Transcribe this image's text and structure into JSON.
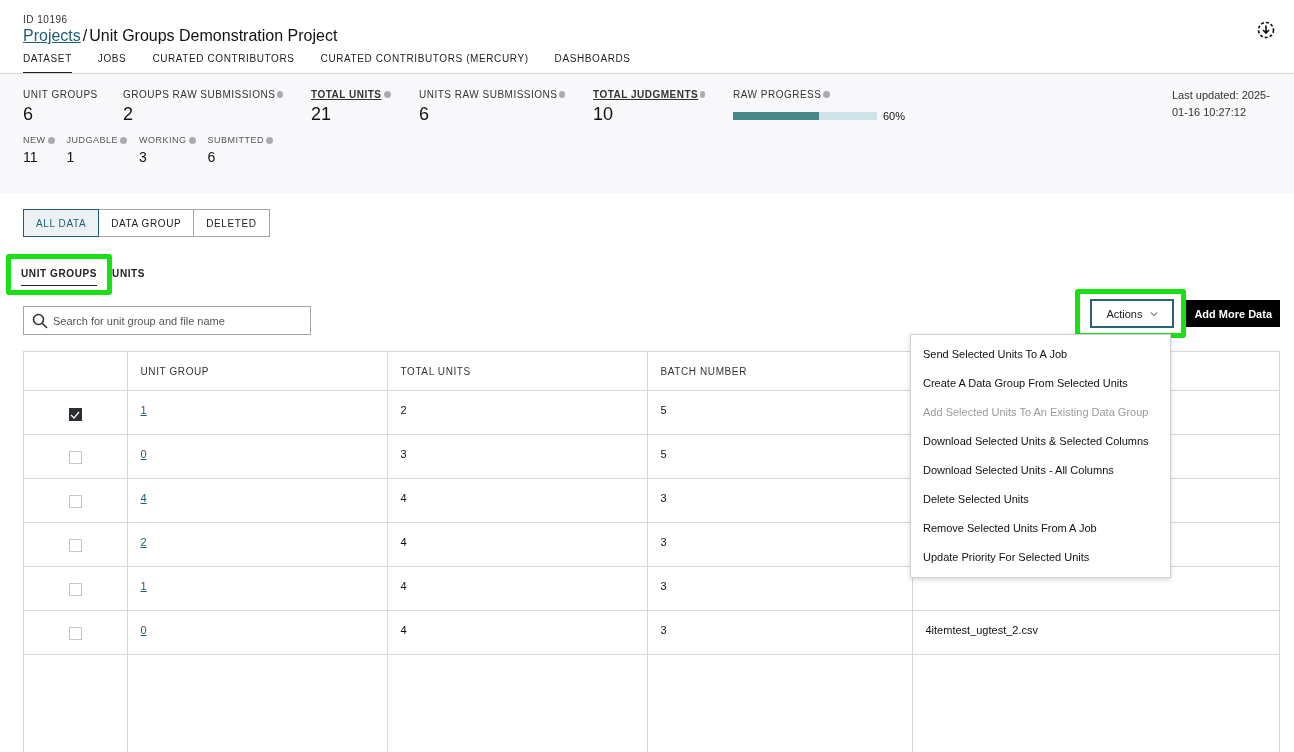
{
  "header": {
    "id_label": "ID 10196",
    "breadcrumb_link": "Projects",
    "separator": "/",
    "title": "Unit Groups Demonstration Project"
  },
  "nav_tabs": [
    {
      "label": "DATASET",
      "selected": true
    },
    {
      "label": "JOBS",
      "selected": false
    },
    {
      "label": "CURATED CONTRIBUTORS",
      "selected": false
    },
    {
      "label": "CURATED CONTRIBUTORS (MERCURY)",
      "selected": false
    },
    {
      "label": "DASHBOARDS",
      "selected": false
    }
  ],
  "stats": [
    {
      "label": "UNIT GROUPS",
      "value": "6",
      "info": false,
      "underlined": false
    },
    {
      "label": "GROUPS RAW SUBMISSIONS",
      "value": "2",
      "info": true,
      "underlined": false
    },
    {
      "label": "TOTAL UNITS",
      "value": "21",
      "info": true,
      "underlined": true
    },
    {
      "label": "UNITS RAW SUBMISSIONS",
      "value": "6",
      "info": true,
      "underlined": false
    },
    {
      "label": "TOTAL JUDGMENTS",
      "value": "10",
      "info": true,
      "underlined": true
    }
  ],
  "raw_progress": {
    "label": "RAW PROGRESS",
    "level": 0.6,
    "reading": "60%"
  },
  "last_updated": "Last updated: 2025-01-16 10:27:12",
  "sub_stats": [
    {
      "label": "NEW",
      "value": "11"
    },
    {
      "label": "JUDGABLE",
      "value": "1"
    },
    {
      "label": "WORKING",
      "value": "3"
    },
    {
      "label": "SUBMITTED",
      "value": "6"
    }
  ],
  "segments": [
    {
      "label": "ALL DATA",
      "selected": true
    },
    {
      "label": "DATA GROUP",
      "selected": false
    },
    {
      "label": "DELETED",
      "selected": false
    }
  ],
  "view_tabs": [
    {
      "label": "UNIT GROUPS",
      "selected": true,
      "highlighted": true
    },
    {
      "label": "UNITS",
      "selected": false,
      "highlighted": false
    }
  ],
  "search": {
    "placeholder": "Search for unit group and file name"
  },
  "actions_button": {
    "label": "Actions",
    "highlighted": true
  },
  "add_button": "Add More Data",
  "actions_menu": [
    {
      "label": "Send Selected Units To A Job",
      "disabled": false
    },
    {
      "label": "Create A Data Group From Selected Units",
      "disabled": false
    },
    {
      "label": "Add Selected Units To An Existing Data Group",
      "disabled": true
    },
    {
      "label": "Download Selected Units & Selected Columns",
      "disabled": false
    },
    {
      "label": "Download Selected Units - All Columns",
      "disabled": false
    },
    {
      "label": "Delete Selected Units",
      "disabled": false
    },
    {
      "label": "Remove Selected Units From A Job",
      "disabled": false
    },
    {
      "label": "Update Priority For Selected Units",
      "disabled": false
    }
  ],
  "table": {
    "columns": [
      "UNIT GROUP",
      "TOTAL UNITS",
      "BATCH NUMBER"
    ],
    "rows": [
      {
        "checked": true,
        "unit_group": "1",
        "total_units": "2",
        "batch_number": "5"
      },
      {
        "checked": false,
        "unit_group": "0",
        "total_units": "3",
        "batch_number": "5"
      },
      {
        "checked": false,
        "unit_group": "4",
        "total_units": "4",
        "batch_number": "3"
      },
      {
        "checked": false,
        "unit_group": "2",
        "total_units": "4",
        "batch_number": "3"
      },
      {
        "checked": false,
        "unit_group": "1",
        "total_units": "4",
        "batch_number": "3"
      },
      {
        "checked": false,
        "unit_group": "0",
        "total_units": "4",
        "batch_number": "3",
        "column_5": "4itemtest_ugtest_2.csv"
      }
    ]
  }
}
